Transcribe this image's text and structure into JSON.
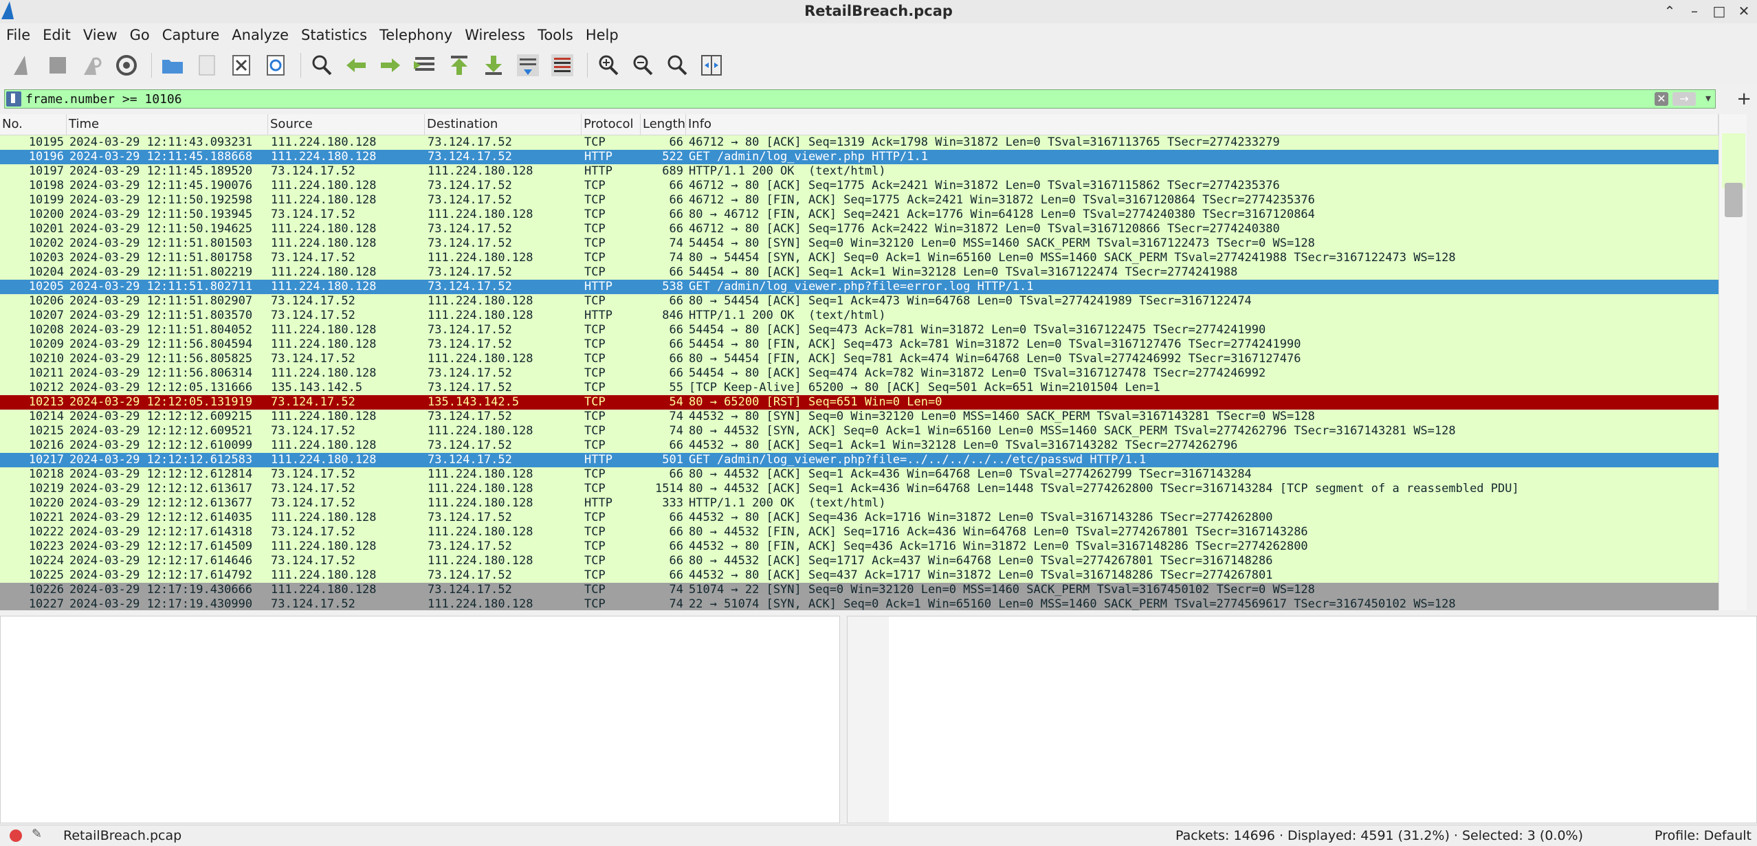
{
  "window": {
    "title": "RetailBreach.pcap"
  },
  "menu": [
    "File",
    "Edit",
    "View",
    "Go",
    "Capture",
    "Analyze",
    "Statistics",
    "Telephony",
    "Wireless",
    "Tools",
    "Help"
  ],
  "filter": {
    "value": "frame.number >= 10106",
    "bg_color": "#afffaf"
  },
  "columns": [
    "No.",
    "Time",
    "Source",
    "Destination",
    "Protocol",
    "Length",
    "Info"
  ],
  "packets": [
    {
      "no": "10195",
      "time": "2024-03-29 12:11:43.093231",
      "src": "111.224.180.128",
      "dst": "73.124.17.52",
      "proto": "TCP",
      "len": "66",
      "info": "46712 → 80 [ACK] Seq=1319 Ack=1798 Win=31872 Len=0 TSval=3167113765 TSecr=2774233279",
      "style": "tcpg"
    },
    {
      "no": "10196",
      "time": "2024-03-29 12:11:45.188668",
      "src": "111.224.180.128",
      "dst": "73.124.17.52",
      "proto": "HTTP",
      "len": "522",
      "info": "GET /admin/log_viewer.php HTTP/1.1",
      "style": "sel"
    },
    {
      "no": "10197",
      "time": "2024-03-29 12:11:45.189520",
      "src": "73.124.17.52",
      "dst": "111.224.180.128",
      "proto": "HTTP",
      "len": "689",
      "info": "HTTP/1.1 200 OK  (text/html)",
      "style": "http"
    },
    {
      "no": "10198",
      "time": "2024-03-29 12:11:45.190076",
      "src": "111.224.180.128",
      "dst": "73.124.17.52",
      "proto": "TCP",
      "len": "66",
      "info": "46712 → 80 [ACK] Seq=1775 Ack=2421 Win=31872 Len=0 TSval=3167115862 TSecr=2774235376",
      "style": "tcpg"
    },
    {
      "no": "10199",
      "time": "2024-03-29 12:11:50.192598",
      "src": "111.224.180.128",
      "dst": "73.124.17.52",
      "proto": "TCP",
      "len": "66",
      "info": "46712 → 80 [FIN, ACK] Seq=1775 Ack=2421 Win=31872 Len=0 TSval=3167120864 TSecr=2774235376",
      "style": "tcpg"
    },
    {
      "no": "10200",
      "time": "2024-03-29 12:11:50.193945",
      "src": "73.124.17.52",
      "dst": "111.224.180.128",
      "proto": "TCP",
      "len": "66",
      "info": "80 → 46712 [FIN, ACK] Seq=2421 Ack=1776 Win=64128 Len=0 TSval=2774240380 TSecr=3167120864",
      "style": "tcpg"
    },
    {
      "no": "10201",
      "time": "2024-03-29 12:11:50.194625",
      "src": "111.224.180.128",
      "dst": "73.124.17.52",
      "proto": "TCP",
      "len": "66",
      "info": "46712 → 80 [ACK] Seq=1776 Ack=2422 Win=31872 Len=0 TSval=3167120866 TSecr=2774240380",
      "style": "tcpg"
    },
    {
      "no": "10202",
      "time": "2024-03-29 12:11:51.801503",
      "src": "111.224.180.128",
      "dst": "73.124.17.52",
      "proto": "TCP",
      "len": "74",
      "info": "54454 → 80 [SYN] Seq=0 Win=32120 Len=0 MSS=1460 SACK_PERM TSval=3167122473 TSecr=0 WS=128",
      "style": "tcpg"
    },
    {
      "no": "10203",
      "time": "2024-03-29 12:11:51.801758",
      "src": "73.124.17.52",
      "dst": "111.224.180.128",
      "proto": "TCP",
      "len": "74",
      "info": "80 → 54454 [SYN, ACK] Seq=0 Ack=1 Win=65160 Len=0 MSS=1460 SACK_PERM TSval=2774241988 TSecr=3167122473 WS=128",
      "style": "tcpg"
    },
    {
      "no": "10204",
      "time": "2024-03-29 12:11:51.802219",
      "src": "111.224.180.128",
      "dst": "73.124.17.52",
      "proto": "TCP",
      "len": "66",
      "info": "54454 → 80 [ACK] Seq=1 Ack=1 Win=32128 Len=0 TSval=3167122474 TSecr=2774241988",
      "style": "tcpg"
    },
    {
      "no": "10205",
      "time": "2024-03-29 12:11:51.802711",
      "src": "111.224.180.128",
      "dst": "73.124.17.52",
      "proto": "HTTP",
      "len": "538",
      "info": "GET /admin/log_viewer.php?file=error.log HTTP/1.1",
      "style": "sel"
    },
    {
      "no": "10206",
      "time": "2024-03-29 12:11:51.802907",
      "src": "73.124.17.52",
      "dst": "111.224.180.128",
      "proto": "TCP",
      "len": "66",
      "info": "80 → 54454 [ACK] Seq=1 Ack=473 Win=64768 Len=0 TSval=2774241989 TSecr=3167122474",
      "style": "tcpg"
    },
    {
      "no": "10207",
      "time": "2024-03-29 12:11:51.803570",
      "src": "73.124.17.52",
      "dst": "111.224.180.128",
      "proto": "HTTP",
      "len": "846",
      "info": "HTTP/1.1 200 OK  (text/html)",
      "style": "http"
    },
    {
      "no": "10208",
      "time": "2024-03-29 12:11:51.804052",
      "src": "111.224.180.128",
      "dst": "73.124.17.52",
      "proto": "TCP",
      "len": "66",
      "info": "54454 → 80 [ACK] Seq=473 Ack=781 Win=31872 Len=0 TSval=3167122475 TSecr=2774241990",
      "style": "tcpg"
    },
    {
      "no": "10209",
      "time": "2024-03-29 12:11:56.804594",
      "src": "111.224.180.128",
      "dst": "73.124.17.52",
      "proto": "TCP",
      "len": "66",
      "info": "54454 → 80 [FIN, ACK] Seq=473 Ack=781 Win=31872 Len=0 TSval=3167127476 TSecr=2774241990",
      "style": "tcpg"
    },
    {
      "no": "10210",
      "time": "2024-03-29 12:11:56.805825",
      "src": "73.124.17.52",
      "dst": "111.224.180.128",
      "proto": "TCP",
      "len": "66",
      "info": "80 → 54454 [FIN, ACK] Seq=781 Ack=474 Win=64768 Len=0 TSval=2774246992 TSecr=3167127476",
      "style": "tcpg"
    },
    {
      "no": "10211",
      "time": "2024-03-29 12:11:56.806314",
      "src": "111.224.180.128",
      "dst": "73.124.17.52",
      "proto": "TCP",
      "len": "66",
      "info": "54454 → 80 [ACK] Seq=474 Ack=782 Win=31872 Len=0 TSval=3167127478 TSecr=2774246992",
      "style": "tcpg"
    },
    {
      "no": "10212",
      "time": "2024-03-29 12:12:05.131666",
      "src": "135.143.142.5",
      "dst": "73.124.17.52",
      "proto": "TCP",
      "len": "55",
      "info": "[TCP Keep-Alive] 65200 → 80 [ACK] Seq=501 Ack=651 Win=2101504 Len=1",
      "style": "tcpg"
    },
    {
      "no": "10213",
      "time": "2024-03-29 12:12:05.131919",
      "src": "73.124.17.52",
      "dst": "135.143.142.5",
      "proto": "TCP",
      "len": "54",
      "info": "80 → 65200 [RST] Seq=651 Win=0 Len=0",
      "style": "rst"
    },
    {
      "no": "10214",
      "time": "2024-03-29 12:12:12.609215",
      "src": "111.224.180.128",
      "dst": "73.124.17.52",
      "proto": "TCP",
      "len": "74",
      "info": "44532 → 80 [SYN] Seq=0 Win=32120 Len=0 MSS=1460 SACK_PERM TSval=3167143281 TSecr=0 WS=128",
      "style": "tcpg"
    },
    {
      "no": "10215",
      "time": "2024-03-29 12:12:12.609521",
      "src": "73.124.17.52",
      "dst": "111.224.180.128",
      "proto": "TCP",
      "len": "74",
      "info": "80 → 44532 [SYN, ACK] Seq=0 Ack=1 Win=65160 Len=0 MSS=1460 SACK_PERM TSval=2774262796 TSecr=3167143281 WS=128",
      "style": "tcpg"
    },
    {
      "no": "10216",
      "time": "2024-03-29 12:12:12.610099",
      "src": "111.224.180.128",
      "dst": "73.124.17.52",
      "proto": "TCP",
      "len": "66",
      "info": "44532 → 80 [ACK] Seq=1 Ack=1 Win=32128 Len=0 TSval=3167143282 TSecr=2774262796",
      "style": "tcpg"
    },
    {
      "no": "10217",
      "time": "2024-03-29 12:12:12.612583",
      "src": "111.224.180.128",
      "dst": "73.124.17.52",
      "proto": "HTTP",
      "len": "501",
      "info": "GET /admin/log_viewer.php?file=../../../../../etc/passwd HTTP/1.1",
      "style": "sel"
    },
    {
      "no": "10218",
      "time": "2024-03-29 12:12:12.612814",
      "src": "73.124.17.52",
      "dst": "111.224.180.128",
      "proto": "TCP",
      "len": "66",
      "info": "80 → 44532 [ACK] Seq=1 Ack=436 Win=64768 Len=0 TSval=2774262799 TSecr=3167143284",
      "style": "tcpg"
    },
    {
      "no": "10219",
      "time": "2024-03-29 12:12:12.613617",
      "src": "73.124.17.52",
      "dst": "111.224.180.128",
      "proto": "TCP",
      "len": "1514",
      "info": "80 → 44532 [ACK] Seq=1 Ack=436 Win=64768 Len=1448 TSval=2774262800 TSecr=3167143284 [TCP segment of a reassembled PDU]",
      "style": "tcpg"
    },
    {
      "no": "10220",
      "time": "2024-03-29 12:12:12.613677",
      "src": "73.124.17.52",
      "dst": "111.224.180.128",
      "proto": "HTTP",
      "len": "333",
      "info": "HTTP/1.1 200 OK  (text/html)",
      "style": "http"
    },
    {
      "no": "10221",
      "time": "2024-03-29 12:12:12.614035",
      "src": "111.224.180.128",
      "dst": "73.124.17.52",
      "proto": "TCP",
      "len": "66",
      "info": "44532 → 80 [ACK] Seq=436 Ack=1716 Win=31872 Len=0 TSval=3167143286 TSecr=2774262800",
      "style": "tcpg"
    },
    {
      "no": "10222",
      "time": "2024-03-29 12:12:17.614318",
      "src": "73.124.17.52",
      "dst": "111.224.180.128",
      "proto": "TCP",
      "len": "66",
      "info": "80 → 44532 [FIN, ACK] Seq=1716 Ack=436 Win=64768 Len=0 TSval=2774267801 TSecr=3167143286",
      "style": "tcpg"
    },
    {
      "no": "10223",
      "time": "2024-03-29 12:12:17.614509",
      "src": "111.224.180.128",
      "dst": "73.124.17.52",
      "proto": "TCP",
      "len": "66",
      "info": "44532 → 80 [FIN, ACK] Seq=436 Ack=1716 Win=31872 Len=0 TSval=3167148286 TSecr=2774262800",
      "style": "tcpg"
    },
    {
      "no": "10224",
      "time": "2024-03-29 12:12:17.614646",
      "src": "73.124.17.52",
      "dst": "111.224.180.128",
      "proto": "TCP",
      "len": "66",
      "info": "80 → 44532 [ACK] Seq=1717 Ack=437 Win=64768 Len=0 TSval=2774267801 TSecr=3167148286",
      "style": "tcpg"
    },
    {
      "no": "10225",
      "time": "2024-03-29 12:12:17.614792",
      "src": "111.224.180.128",
      "dst": "73.124.17.52",
      "proto": "TCP",
      "len": "66",
      "info": "44532 → 80 [ACK] Seq=437 Ack=1717 Win=31872 Len=0 TSval=3167148286 TSecr=2774267801",
      "style": "tcpg"
    },
    {
      "no": "10226",
      "time": "2024-03-29 12:17:19.430666",
      "src": "111.224.180.128",
      "dst": "73.124.17.52",
      "proto": "TCP",
      "len": "74",
      "info": "51074 → 22 [SYN] Seq=0 Win=32120 Len=0 MSS=1460 SACK_PERM TSval=3167450102 TSecr=0 WS=128",
      "style": "syn"
    },
    {
      "no": "10227",
      "time": "2024-03-29 12:17:19.430990",
      "src": "73.124.17.52",
      "dst": "111.224.180.128",
      "proto": "TCP",
      "len": "74",
      "info": "22 → 51074 [SYN, ACK] Seq=0 Ack=1 Win=65160 Len=0 MSS=1460 SACK_PERM TSval=2774569617 TSecr=3167450102 WS=128",
      "style": "syn"
    }
  ],
  "status": {
    "file": "RetailBreach.pcap",
    "stats": "Packets: 14696 · Displayed: 4591 (31.2%) · Selected: 3 (0.0%)",
    "profile": "Profile: Default"
  },
  "toolbar_icons": [
    "shark-fin-start-icon",
    "stop-capture-icon",
    "restart-capture-icon",
    "capture-options-icon",
    "open-file-icon",
    "save-file-icon",
    "close-file-icon",
    "reload-file-icon",
    "find-packet-icon",
    "go-back-icon",
    "go-forward-icon",
    "go-to-packet-icon",
    "go-first-icon",
    "go-last-icon",
    "autoscroll-icon",
    "colorize-icon",
    "zoom-in-icon",
    "zoom-out-icon",
    "zoom-normal-icon",
    "resize-columns-icon"
  ]
}
